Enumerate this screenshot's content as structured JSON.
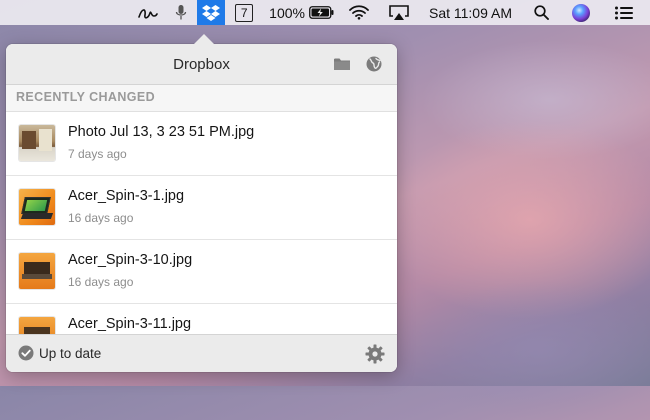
{
  "menubar": {
    "battery_percent": "100%",
    "clock": "Sat 11:09 AM",
    "calendar_day": "7",
    "dropbox_accent": "#1f7ae8"
  },
  "popover": {
    "title": "Dropbox",
    "section_label": "RECENTLY CHANGED",
    "files": [
      {
        "name": "Photo Jul 13, 3 23 51 PM.jpg",
        "modified": "7 days ago"
      },
      {
        "name": "Acer_Spin-3-1.jpg",
        "modified": "16 days ago"
      },
      {
        "name": "Acer_Spin-3-10.jpg",
        "modified": "16 days ago"
      },
      {
        "name": "Acer_Spin-3-11.jpg",
        "modified": ""
      }
    ],
    "status": "Up to date"
  }
}
